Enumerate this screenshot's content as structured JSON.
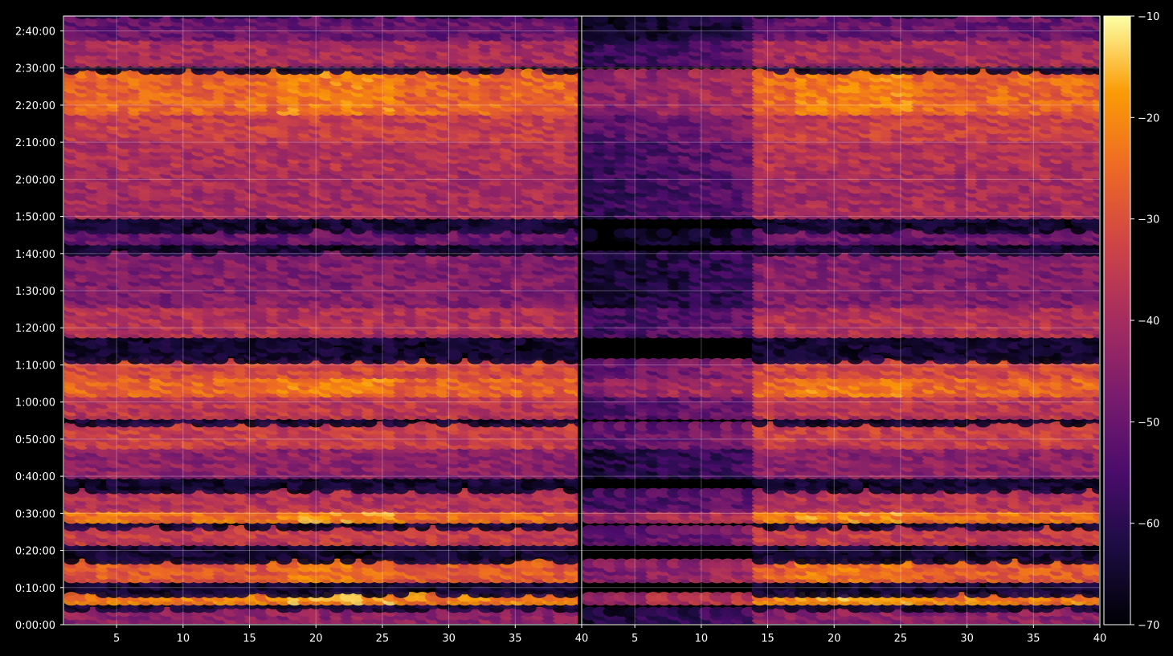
{
  "chart_data": {
    "type": "heatmap",
    "title": "",
    "xlabel": "",
    "ylabel": "",
    "colormap": "inferno",
    "background": "#000000",
    "grid": true,
    "panels": [
      {
        "xlim": [
          1,
          40
        ],
        "x_ticks": [
          "5",
          "10",
          "15",
          "20",
          "25",
          "30",
          "35",
          "40"
        ],
        "x_tick_values": [
          5,
          10,
          15,
          20,
          25,
          30,
          35,
          40
        ]
      },
      {
        "xlim": [
          1,
          40
        ],
        "x_ticks": [
          "5",
          "10",
          "15",
          "20",
          "25",
          "30",
          "35",
          "40"
        ],
        "x_tick_values": [
          5,
          10,
          15,
          20,
          25,
          30,
          35,
          40
        ]
      }
    ],
    "y_seconds_range": [
      0,
      9840
    ],
    "y_ticks": [
      "0:00:00",
      "0:10:00",
      "0:20:00",
      "0:30:00",
      "0:40:00",
      "0:50:00",
      "1:00:00",
      "1:10:00",
      "1:20:00",
      "1:30:00",
      "1:40:00",
      "1:50:00",
      "2:00:00",
      "2:10:00",
      "2:20:00",
      "2:30:00",
      "2:40:00"
    ],
    "colorbar": {
      "range": [
        -70,
        -10
      ],
      "ticks": [
        "−70",
        "−60",
        "−50",
        "−40",
        "−30",
        "−20",
        "−10"
      ],
      "tick_values": [
        -70,
        -60,
        -50,
        -40,
        -30,
        -20,
        -10
      ]
    },
    "bands": [
      {
        "start": "0:00:00",
        "end": "0:04:00",
        "level": -44
      },
      {
        "start": "0:06:00",
        "end": "0:08:00",
        "level": -22
      },
      {
        "start": "0:12:00",
        "end": "0:17:00",
        "level": -28
      },
      {
        "start": "0:22:00",
        "end": "0:26:00",
        "level": -35
      },
      {
        "start": "0:28:00",
        "end": "0:31:00",
        "level": -24
      },
      {
        "start": "0:31:00",
        "end": "0:36:00",
        "level": -38
      },
      {
        "start": "0:40:00",
        "end": "0:48:00",
        "level": -44
      },
      {
        "start": "0:48:00",
        "end": "0:54:00",
        "level": -34
      },
      {
        "start": "0:56:00",
        "end": "1:02:00",
        "level": -36
      },
      {
        "start": "1:02:00",
        "end": "1:07:00",
        "level": -26
      },
      {
        "start": "1:07:00",
        "end": "1:11:00",
        "level": -32
      },
      {
        "start": "1:18:00",
        "end": "1:26:00",
        "level": -38
      },
      {
        "start": "1:26:00",
        "end": "1:40:00",
        "level": -46
      },
      {
        "start": "1:43:00",
        "end": "1:46:00",
        "level": -50
      },
      {
        "start": "1:50:00",
        "end": "2:03:00",
        "level": -40
      },
      {
        "start": "2:03:00",
        "end": "2:11:00",
        "level": -38
      },
      {
        "start": "2:11:00",
        "end": "2:18:00",
        "level": -34
      },
      {
        "start": "2:18:00",
        "end": "2:29:00",
        "level": -26
      },
      {
        "start": "2:31:00",
        "end": "2:38:00",
        "level": -40
      },
      {
        "start": "2:38:00",
        "end": "2:44:00",
        "level": -50
      }
    ]
  }
}
